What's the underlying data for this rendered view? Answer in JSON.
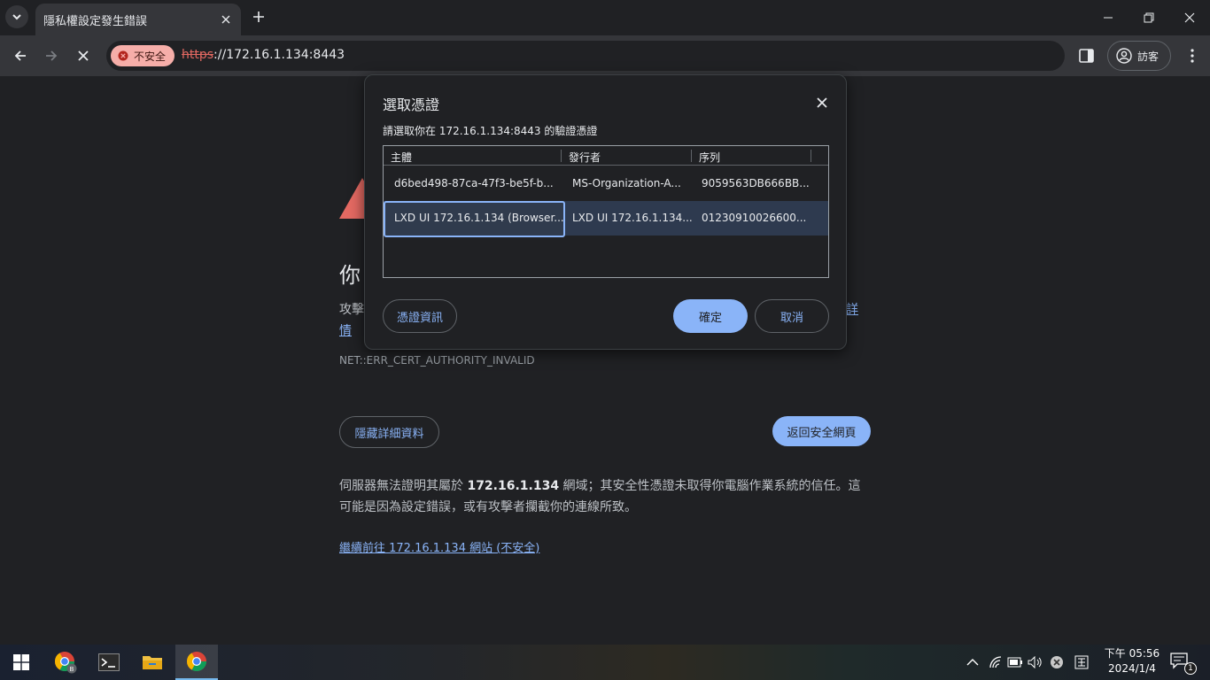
{
  "browser": {
    "tab": {
      "title": "隱私權設定發生錯誤"
    },
    "omnibox": {
      "security_chip": "不安全",
      "url_scheme": "https",
      "url_rest": "://172.16.1.134:8443"
    },
    "profile_label": "訪客"
  },
  "page": {
    "heading": "你",
    "para_start": "攻擊",
    "details_link_a": "詳",
    "details_link_b": "情",
    "error_code": "NET::ERR_CERT_AUTHORITY_INVALID",
    "hide_details_button": "隱藏詳細資料",
    "back_to_safety_button": "返回安全網頁",
    "explanation_pre": "伺服器無法證明其屬於",
    "explanation_host": "172.16.1.134",
    "explanation_post": "網域；其安全性憑證未取得你電腦作業系統的信任。這可能是因為設定錯誤，或有攻擊者攔截你的連線所致。",
    "proceed_link": "繼續前往 172.16.1.134 網站 (不安全)"
  },
  "dialog": {
    "title": "選取憑證",
    "subtitle": "請選取你在 172.16.1.134:8443 的驗證憑證",
    "columns": [
      "主體",
      "發行者",
      "序列"
    ],
    "rows": [
      {
        "subject": "d6bed498-87ca-47f3-be5f-b...",
        "issuer": "MS-Organization-A...",
        "serial": "9059563DB666BB..."
      },
      {
        "subject": "LXD UI 172.16.1.134 (Browser...",
        "issuer": "LXD UI 172.16.1.134...",
        "serial": "01230910026600..."
      }
    ],
    "selected_row": 1,
    "cert_info_button": "憑證資訊",
    "ok_button": "確定",
    "cancel_button": "取消"
  },
  "taskbar": {
    "time": "下午 05:56",
    "date": "2024/1/4",
    "notification_count": "1"
  }
}
